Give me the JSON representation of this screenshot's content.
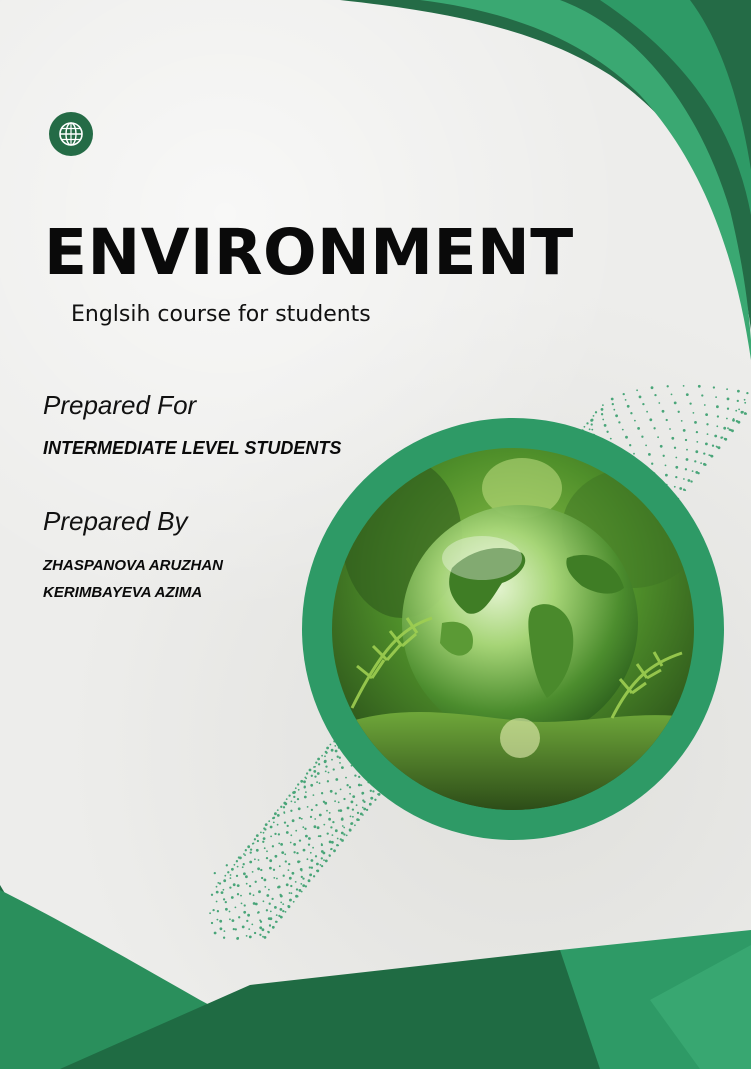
{
  "cover": {
    "title": "ENVIRONMENT",
    "subtitle": "Englsih course for students",
    "prepared_for_label": "Prepared For",
    "prepared_for_value": "INTERMEDIATE LEVEL STUDENTS",
    "prepared_by_label": "Prepared By",
    "authors": [
      "ZHASPANOVA ARUZHAN",
      "KERIMBAYEVA AZIMA"
    ]
  },
  "icons": {
    "top_left": "globe-icon"
  },
  "colors": {
    "dark_green": "#246b46",
    "accent_green": "#2e9a66",
    "light_green": "#3aa872",
    "background": "#ededeb",
    "text": "#0a0a0a"
  }
}
